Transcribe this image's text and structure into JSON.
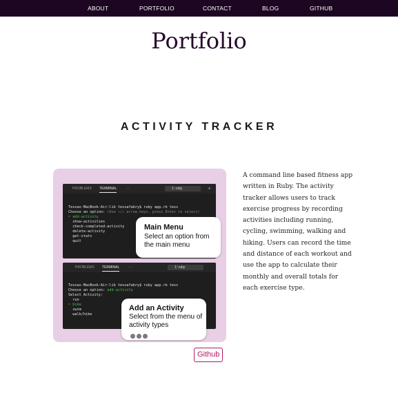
{
  "nav": {
    "about": "ABOUT",
    "portfolio": "PORTFOLIO",
    "contact": "CONTACT",
    "blog": "BLOG",
    "github": "GITHUB"
  },
  "page_title": "Portfolio",
  "project": {
    "title": "ACTIVITY TRACKER",
    "description": "A command line based fitness app written in Ruby. The activity tracker allows users to track exercise progress by recording activities including running, cycling, swimming, walking and hiking. Users can record the time and distance of each workout and use the app to calculate their monthly and overall totals for each exercise type.",
    "github_label": "Github",
    "screenshot": {
      "terminal1": {
        "tab_problems": "PROBLEMS",
        "tab_terminal": "TERMINAL",
        "tab_more": "···",
        "shell_select": "1: ruby",
        "plus": "+",
        "line1": "Tessas-MacBook-Air:lib tessafabry$ ruby app.rb tess",
        "line2_a": "Choose an option: ",
        "line2_b": "(Use ↑/↓ arrow keys, press Enter to select)",
        "line3": "‣ add-activity",
        "line4": "  show-activities",
        "line5": "  check-completed-activity",
        "line6": "  delete-activity",
        "line7": "  get-stats",
        "line8": "  quit",
        "callout_title": "Main Menu",
        "callout_body": "Select an option from the main menu"
      },
      "terminal2": {
        "tab_problems": "PROBLEMS",
        "tab_terminal": "TERMINAL",
        "tab_more": "···",
        "shell_select": "1: ruby",
        "line1": "Tessas-MacBook-Air:lib tessafabry$ ruby app.rb tess",
        "line2_a": "Choose an option: ",
        "line2_b": "add-activity",
        "line3": "Select Activity:",
        "line4": "  run",
        "line5": "‣ bike",
        "line6": "  swim",
        "line7": "  walk/hike",
        "callout_title": "Add an Activity",
        "callout_body": "Select from the menu of activity types"
      }
    }
  },
  "colors": {
    "nav_bg": "#1d0622",
    "card_bg": "#e8cfe6",
    "accent": "#b31c64"
  }
}
